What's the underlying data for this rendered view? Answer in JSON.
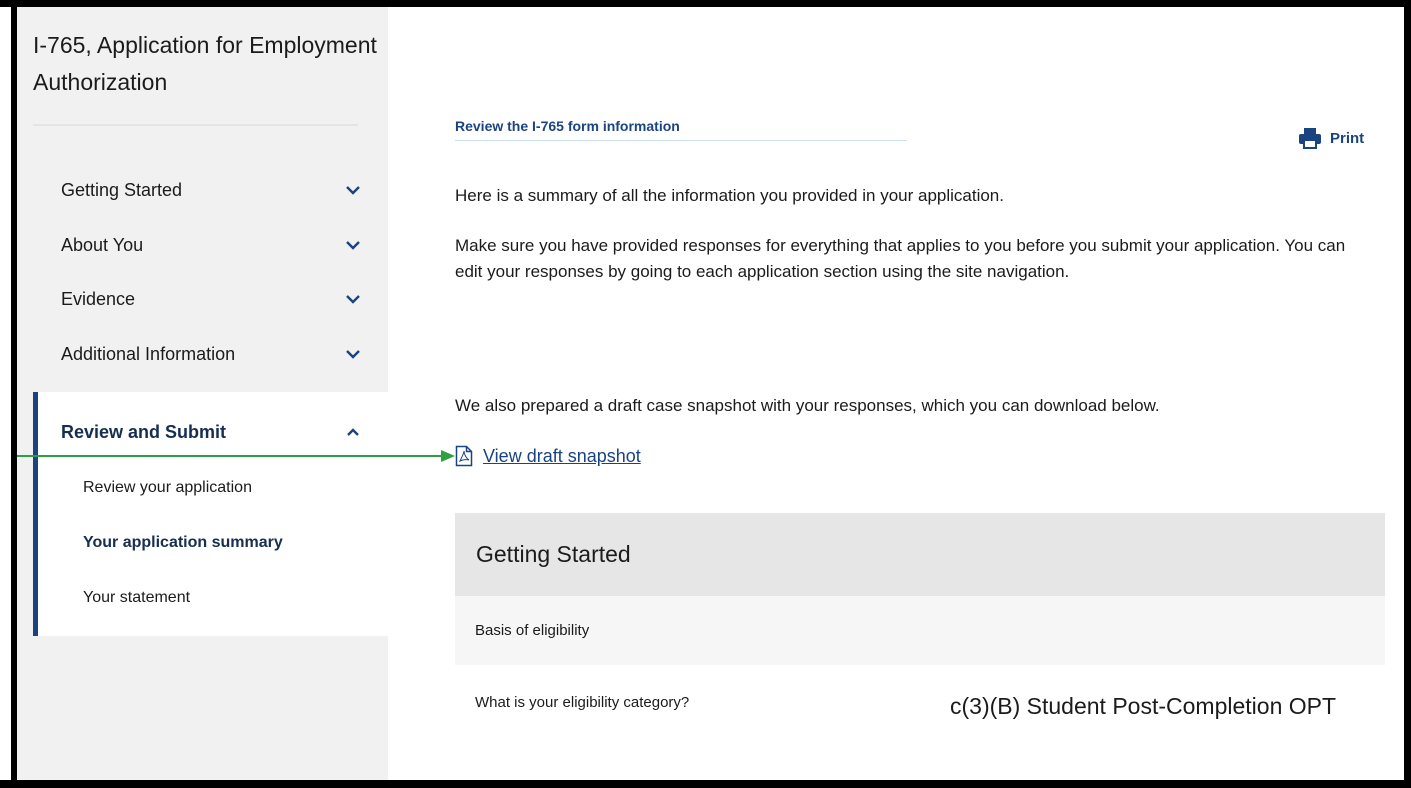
{
  "sidebar": {
    "form_title": "I-765, Application for Employment Authorization",
    "nav_items": [
      {
        "label": "Getting Started"
      },
      {
        "label": "About You"
      },
      {
        "label": "Evidence"
      },
      {
        "label": "Additional Information"
      }
    ],
    "review_section": {
      "label": "Review and Submit",
      "sub_items": [
        {
          "label": "Review your application"
        },
        {
          "label": "Your application summary"
        },
        {
          "label": "Your statement"
        }
      ]
    }
  },
  "main": {
    "heading": "Review the I-765 form information",
    "print_label": "Print",
    "paragraph_1": "Here is a summary of all the information you provided in your application.",
    "paragraph_2": "Make sure you have provided responses for everything that applies to you before you submit your application. You can edit your responses by going to each application section using the site navigation.",
    "paragraph_3": "We also prepared a draft case snapshot with your responses, which you can download below.",
    "snapshot_link": "View draft snapshot",
    "section": {
      "title": "Getting Started",
      "subheading": "Basis of eligibility",
      "question": "What is your eligibility category?",
      "answer": "c(3)(B) Student Post-Completion OPT"
    }
  },
  "colors": {
    "primary": "#1a4480",
    "sidebar_bg": "#f1f1f1",
    "annotation_arrow": "#2ea043"
  }
}
